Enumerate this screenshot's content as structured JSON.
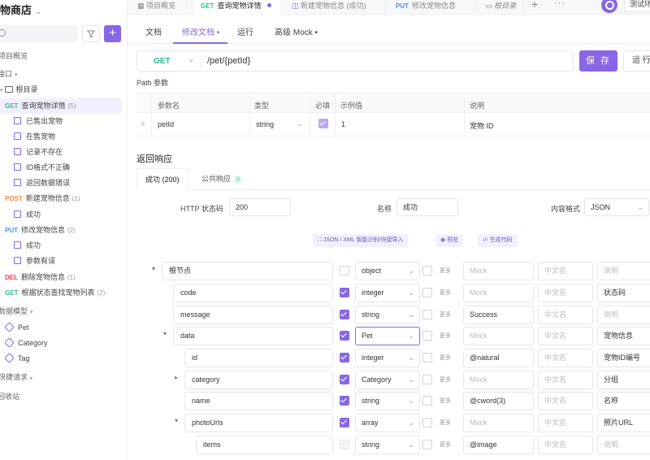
{
  "sidebar": {
    "title": "物商店",
    "items": [
      {
        "text": "项目概览"
      },
      {
        "text": "接口"
      },
      {
        "text": "根目录"
      },
      {
        "method": "GET",
        "text": "查询宠物详情",
        "count": "(5)"
      },
      {
        "text": "已售出宠物"
      },
      {
        "text": "在售宠物"
      },
      {
        "text": "记录不存在"
      },
      {
        "text": "ID格式不正确"
      },
      {
        "text": "返回数据错误"
      },
      {
        "method": "POST",
        "text": "新建宠物信息",
        "count": "(1)"
      },
      {
        "text": "成功"
      },
      {
        "method": "PUT",
        "text": "修改宠物信息",
        "count": "(2)"
      },
      {
        "text": "成功"
      },
      {
        "text": "参数有误"
      },
      {
        "method": "DEL",
        "text": "删除宠物信息",
        "count": "(1)"
      },
      {
        "method": "GET",
        "text": "根据状态查找宠物列表",
        "count": "(2)"
      },
      {
        "text": "数据模型"
      },
      {
        "text": "Pet"
      },
      {
        "text": "Category"
      },
      {
        "text": "Tag"
      },
      {
        "text": "快捷请求"
      },
      {
        "text": "回收站"
      }
    ]
  },
  "tabs": [
    {
      "text": "项目概览"
    },
    {
      "method": "GET",
      "text": "查询宠物详情"
    },
    {
      "text": "新建宠物信息 (成功)"
    },
    {
      "method": "PUT",
      "text": "修改宠物信息"
    },
    {
      "text": "根目录"
    }
  ],
  "env": "测试环",
  "subtabs": [
    "文档",
    "修改文档 •",
    "运行",
    "高级 Mock •"
  ],
  "request": {
    "method": "GET",
    "path": "/pet/{petId}",
    "save": "保 存",
    "run": "运 行"
  },
  "path_params": {
    "title": "Path 参数",
    "headers": [
      "参数名",
      "类型",
      "必填",
      "示例值",
      "说明"
    ],
    "rows": [
      {
        "name": "petId",
        "type": "string",
        "example": "1",
        "desc": "宠物 ID"
      }
    ]
  },
  "response": {
    "title": "返回响应",
    "tabs": [
      {
        "text": "成功 (200)"
      },
      {
        "text": "公共响应",
        "badge": "0"
      }
    ],
    "status_label": "HTTP 状态码",
    "status_value": "200",
    "name_label": "名称",
    "name_value": "成功",
    "format_label": "内容格式",
    "format_value": "JSON",
    "tools": [
      "JSON / XML 智能识别/快捷导入",
      "预览",
      "生成代码"
    ]
  },
  "schema": {
    "more": "更多",
    "cn_placeholder": "中文名",
    "desc_placeholder": "说明",
    "mock_placeholder": "Mock",
    "rows": [
      {
        "name": "根节点",
        "type": "object",
        "mock": "",
        "desc": ""
      },
      {
        "name": "code",
        "type": "integer",
        "mock": "",
        "desc": "状态码"
      },
      {
        "name": "message",
        "type": "string",
        "mock": "Success",
        "desc": ""
      },
      {
        "name": "data",
        "type": "Pet",
        "mock": "",
        "desc": "宠物信息"
      },
      {
        "name": "id",
        "type": "integer",
        "mock": "@natural",
        "desc": "宠物ID编号"
      },
      {
        "name": "category",
        "type": "Category",
        "mock": "",
        "desc": "分组"
      },
      {
        "name": "name",
        "type": "string",
        "mock": "@cword(3)",
        "desc": "名称"
      },
      {
        "name": "photoUrls",
        "type": "array",
        "mock": "",
        "desc": "照片URL"
      },
      {
        "name": "items",
        "type": "string",
        "mock": "@image",
        "desc": ""
      }
    ]
  },
  "colors": {
    "accent": "#8867e6",
    "get": "#2dbb9a",
    "post": "#f08a3c",
    "put": "#4d8ff0",
    "del": "#e5484d"
  }
}
